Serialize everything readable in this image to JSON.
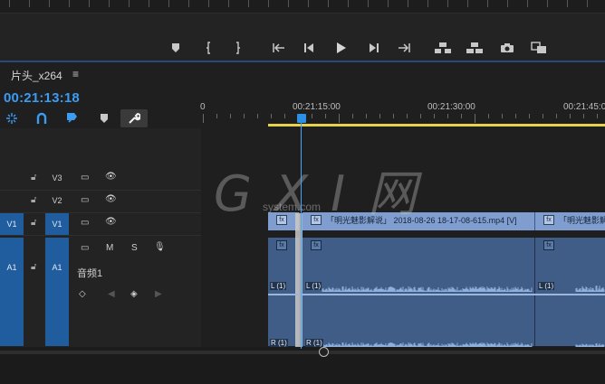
{
  "transport": {
    "buttons": [
      {
        "name": "add-marker-button",
        "icon": "marker-icon"
      },
      {
        "name": "mark-in-button",
        "icon": "mark-in-icon"
      },
      {
        "name": "mark-out-button",
        "icon": "mark-out-icon"
      },
      {
        "name": "go-to-in-button",
        "icon": "go-to-in-icon"
      },
      {
        "name": "step-back-button",
        "icon": "step-back-icon"
      },
      {
        "name": "play-button",
        "icon": "play-icon"
      },
      {
        "name": "step-forward-button",
        "icon": "step-forward-icon"
      },
      {
        "name": "go-to-out-button",
        "icon": "go-to-out-icon"
      },
      {
        "name": "lift-button",
        "icon": "lift-icon"
      },
      {
        "name": "extract-button",
        "icon": "extract-icon"
      },
      {
        "name": "export-frame-button",
        "icon": "camera-icon"
      },
      {
        "name": "comparison-view-button",
        "icon": "comparison-icon"
      }
    ]
  },
  "timeline": {
    "sequence_tab": "片头_x264",
    "menu_symbol": "≡",
    "timecode": "00:21:13:18",
    "ruler": {
      "start_label": "0",
      "labels": [
        "00:21:15:00",
        "00:21:30:00",
        "00:21:45:0"
      ]
    },
    "tools": [
      "snap-icon",
      "linked-selection-icon",
      "add-marker-icon",
      "marker-icon",
      "wrench-icon"
    ]
  },
  "tracks": {
    "video": [
      {
        "target": "",
        "name": "V3"
      },
      {
        "target": "",
        "name": "V2"
      },
      {
        "target": "V1",
        "name": "V1"
      }
    ],
    "audio": [
      {
        "target": "A1",
        "name": "A1",
        "track_label": "音频1",
        "buttons": [
          "M",
          "S"
        ]
      }
    ]
  },
  "clips": {
    "video": [
      {
        "text": "「明光魅影解说」 2018-08-26 18-17-08-615.mp4 [V]"
      },
      {
        "text": "「明光魅影解"
      }
    ],
    "audio_channel_labels": [
      "L (1)",
      "L (1)",
      "L (1)",
      "R (1)",
      "R (1)"
    ]
  },
  "watermark": {
    "main": "G X I 网",
    "sub": "system.com"
  },
  "colors": {
    "accent": "#3b9cf2",
    "video_clip": "#7f9ecf",
    "audio_clip": "#3f5d86",
    "work_area": "#e7d34a",
    "target_on": "#1f5d9e"
  }
}
